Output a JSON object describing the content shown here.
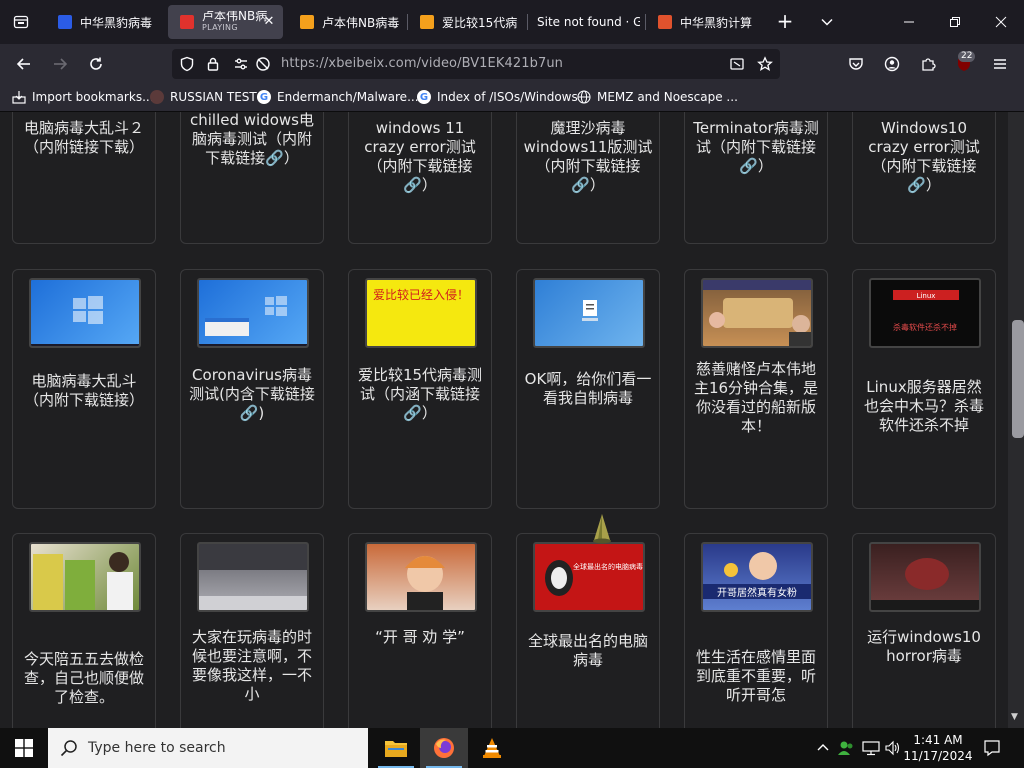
{
  "browser": {
    "tabs": [
      {
        "title": "中华黑豹病毒",
        "fav_color": "#2b5ce6",
        "active": false
      },
      {
        "title": "卢本伟NB病",
        "status": "PLAYING",
        "fav_color": "#e0322d",
        "active": true
      },
      {
        "title": "卢本伟NB病毒",
        "fav_color": "#f4a01c",
        "active": false
      },
      {
        "title": "爱比较15代病",
        "fav_color": "#f4a01c",
        "active": false
      },
      {
        "title": "Site not found · Gi",
        "fav_color": "",
        "active": false
      },
      {
        "title": "中华黑豹计算",
        "fav_color": "#e0522d",
        "active": false
      }
    ],
    "url": "https://xbeibeix.com/video/BV1EK421b7un",
    "extensions_badge": "22",
    "bookmarks": [
      {
        "label": "Import bookmarks...",
        "icon": "import-icon"
      },
      {
        "label": "RUSSIAN TEST",
        "icon": "site-icon"
      },
      {
        "label": "Endermanch/Malware...",
        "icon": "google-icon"
      },
      {
        "label": "Index of /ISOs/Windows",
        "icon": "google-icon"
      },
      {
        "label": "MEMZ and Noescape ...",
        "icon": "globe-icon"
      }
    ]
  },
  "videos": {
    "row1": [
      {
        "title": "电脑病毒大乱斗２（内附链接下载）"
      },
      {
        "title": "chilled widows电脑病毒测试（内附下载链接🔗）"
      },
      {
        "title": "windows 11 crazy error测试（内附下载链接🔗）"
      },
      {
        "title": "魔理沙病毒windows11版测试（内附下载链接🔗）"
      },
      {
        "title": "Terminator病毒测试（内附下载链接🔗）"
      },
      {
        "title": "Windows10 crazy error测试（内附下载链接🔗）"
      }
    ],
    "row2": [
      {
        "title": "电脑病毒大乱斗（内附下载链接）",
        "thumb": "win-desktop"
      },
      {
        "title": "Coronavirus病毒测试(内含下载链接🔗)",
        "thumb": "win-desktop-dialog"
      },
      {
        "title": "爱比较15代病毒测试（内涵下载链接🔗）",
        "thumb": "yellow-banner",
        "thumb_text": "爱比较已经入侵！"
      },
      {
        "title": "OK啊，给你们看一看我自制病毒",
        "thumb": "win-file"
      },
      {
        "title": "慈善赌怪卢本伟地主16分钟合集，是你没看过的船新版本！",
        "thumb": "game"
      },
      {
        "title": "Linux服务器居然也会中木马？杀毒软件还杀不掉",
        "thumb": "dark-text",
        "thumb_text": "杀毒软件还杀不掉"
      }
    ],
    "row3": [
      {
        "title": "今天陪五五去做检查，自己也顺便做了检查。",
        "thumb": "store"
      },
      {
        "title": "大家在玩病毒的时候也要注意啊，不要像我这样，一不小",
        "thumb": "gray-screen"
      },
      {
        "title": "“开 哥 劝 学”",
        "thumb": "portrait"
      },
      {
        "title": "全球最出名的电脑病毒",
        "thumb": "red-banner",
        "thumb_text": "全球最出名的电脑病毒"
      },
      {
        "title": "性生活在感情里面到底重不重要，听听开哥怎",
        "thumb": "stream",
        "thumb_text": "开哥居然真有女粉"
      },
      {
        "title": "运行windows10 horror病毒",
        "thumb": "horror"
      }
    ]
  },
  "taskbar": {
    "search_placeholder": "Type here to search",
    "time": "1:41 AM",
    "date": "11/17/2024"
  }
}
